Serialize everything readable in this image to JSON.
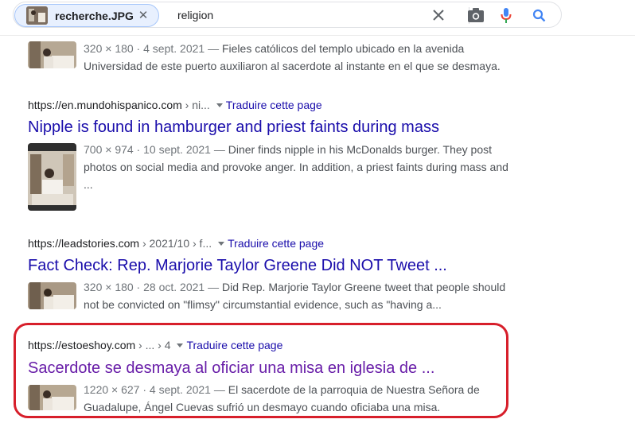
{
  "search": {
    "image_chip_label": "recherche.JPG",
    "query": "religion"
  },
  "results": [
    {
      "url": "",
      "url_crumb": "",
      "translate": "",
      "title": "",
      "meta": "320 × 180 · 4 sept. 2021 — ",
      "snippet": "Fieles católicos del templo ubicado en la avenida Universidad de este puerto auxiliaron al sacerdote al instante en el que se desmaya."
    },
    {
      "url": "https://en.mundohispanico.com",
      "url_crumb": " › ni...",
      "translate": "Traduire cette page",
      "title": "Nipple is found in hamburger and priest faints during mass",
      "meta": "700 × 974 · 10 sept. 2021 — ",
      "snippet": "Diner finds nipple in his McDonalds burger. They post photos on social media and provoke anger. In addition, a priest faints during mass and ..."
    },
    {
      "url": "https://leadstories.com",
      "url_crumb": " › 2021/10 › f...",
      "translate": "Traduire cette page",
      "title": "Fact Check: Rep. Marjorie Taylor Greene Did NOT Tweet ...",
      "meta": "320 × 180 · 28 oct. 2021 — ",
      "snippet": "Did Rep. Marjorie Taylor Greene tweet that people should not be convicted on \"flimsy\" circumstantial evidence, such as \"having a..."
    },
    {
      "url": "https://estoeshoy.com",
      "url_crumb": " › ... › 4",
      "translate": "Traduire cette page",
      "title": "Sacerdote se desmaya al oficiar una misa en iglesia de ...",
      "meta": "1220 × 627 · 4 sept. 2021 — ",
      "snippet": "El sacerdote de la parroquia de Nuestra Señora de Guadalupe, Ángel Cuevas sufrió un desmayo cuando oficiaba una misa."
    }
  ],
  "colors": {
    "link": "#1a0dab",
    "visited": "#681da8",
    "highlight_box": "#d71f2b",
    "mic_blue": "#4285f4",
    "mic_red": "#ea4335"
  }
}
